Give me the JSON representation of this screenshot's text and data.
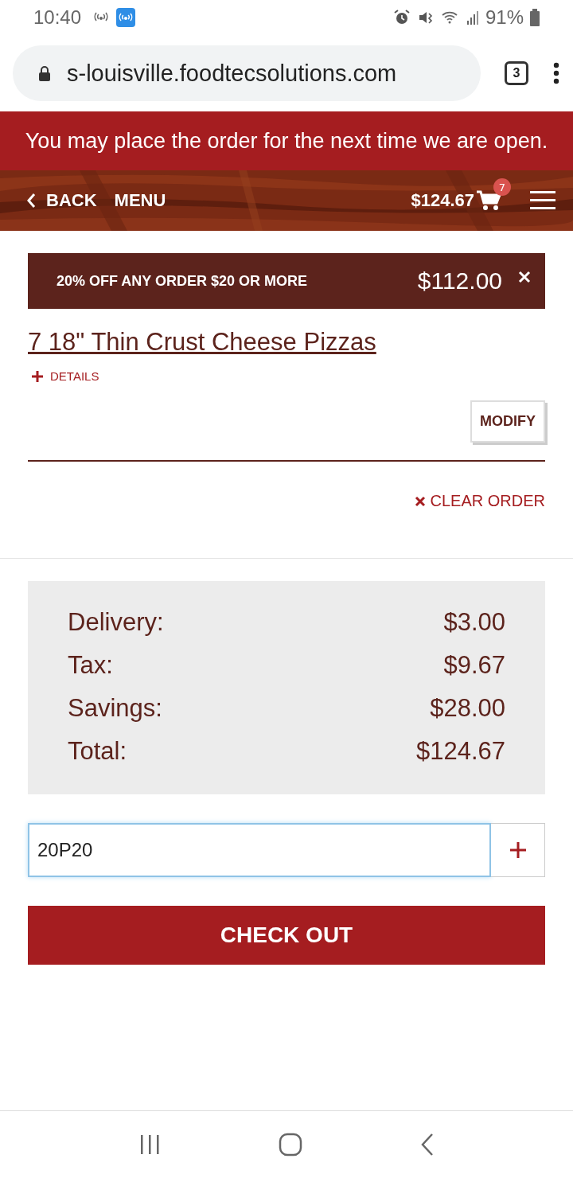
{
  "status_bar": {
    "time": "10:40",
    "battery": "91%"
  },
  "browser": {
    "url": "s-louisville.foodtecsolutions.com",
    "tab_count": "3"
  },
  "notice": "You may place the order for the next time we are open.",
  "nav": {
    "back": "BACK",
    "menu": "MENU",
    "cart_total": "$124.67",
    "cart_count": "7"
  },
  "promo": {
    "label": "20% OFF ANY ORDER $20 OR MORE",
    "amount": "$112.00"
  },
  "item": {
    "title": "7 18\" Thin Crust Cheese Pizzas",
    "details": "DETAILS",
    "modify": "MODIFY"
  },
  "clear_order": "CLEAR ORDER",
  "summary": [
    {
      "label": "Delivery:",
      "value": "$3.00"
    },
    {
      "label": "Tax:",
      "value": "$9.67"
    },
    {
      "label": "Savings:",
      "value": "$28.00"
    },
    {
      "label": "Total:",
      "value": "$124.67"
    }
  ],
  "coupon": {
    "value": "20P20"
  },
  "checkout": "CHECK OUT"
}
